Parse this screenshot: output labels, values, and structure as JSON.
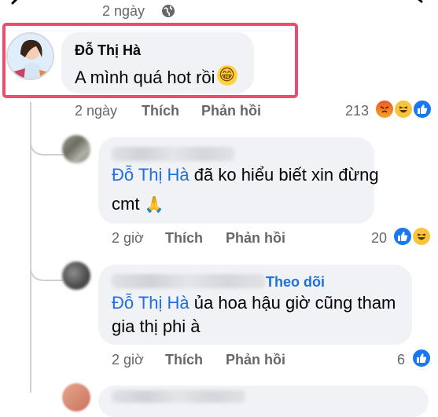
{
  "top": {
    "time": "2 ngày"
  },
  "comment_main": {
    "author": "Đỗ Thị Hà",
    "text": "A mình quá hot rồi",
    "emoji": "😁",
    "time": "2 ngày",
    "like_label": "Thích",
    "reply_label": "Phản hồi",
    "reaction_count": "213"
  },
  "reply1": {
    "mention": "Đỗ Thị Hà",
    "text_line1": "đã ko hiểu biết xin đừng",
    "text_line2": "cmt",
    "emoji": "🙏",
    "time": "2 giờ",
    "like_label": "Thích",
    "reply_label": "Phản hồi",
    "reaction_count": "20"
  },
  "reply2": {
    "follow_label": "Theo dõi",
    "mention": "Đỗ Thị Hà",
    "text_line1": "ủa hoa hậu giờ cũng tham",
    "text_line2": "gia thị phi à",
    "time": "2 giờ",
    "like_label": "Thích",
    "reply_label": "Phản hồi",
    "reaction_count": "6"
  },
  "colors": {
    "highlight": "#f04b6f",
    "link": "#216fdb",
    "like": "#1877f2"
  }
}
